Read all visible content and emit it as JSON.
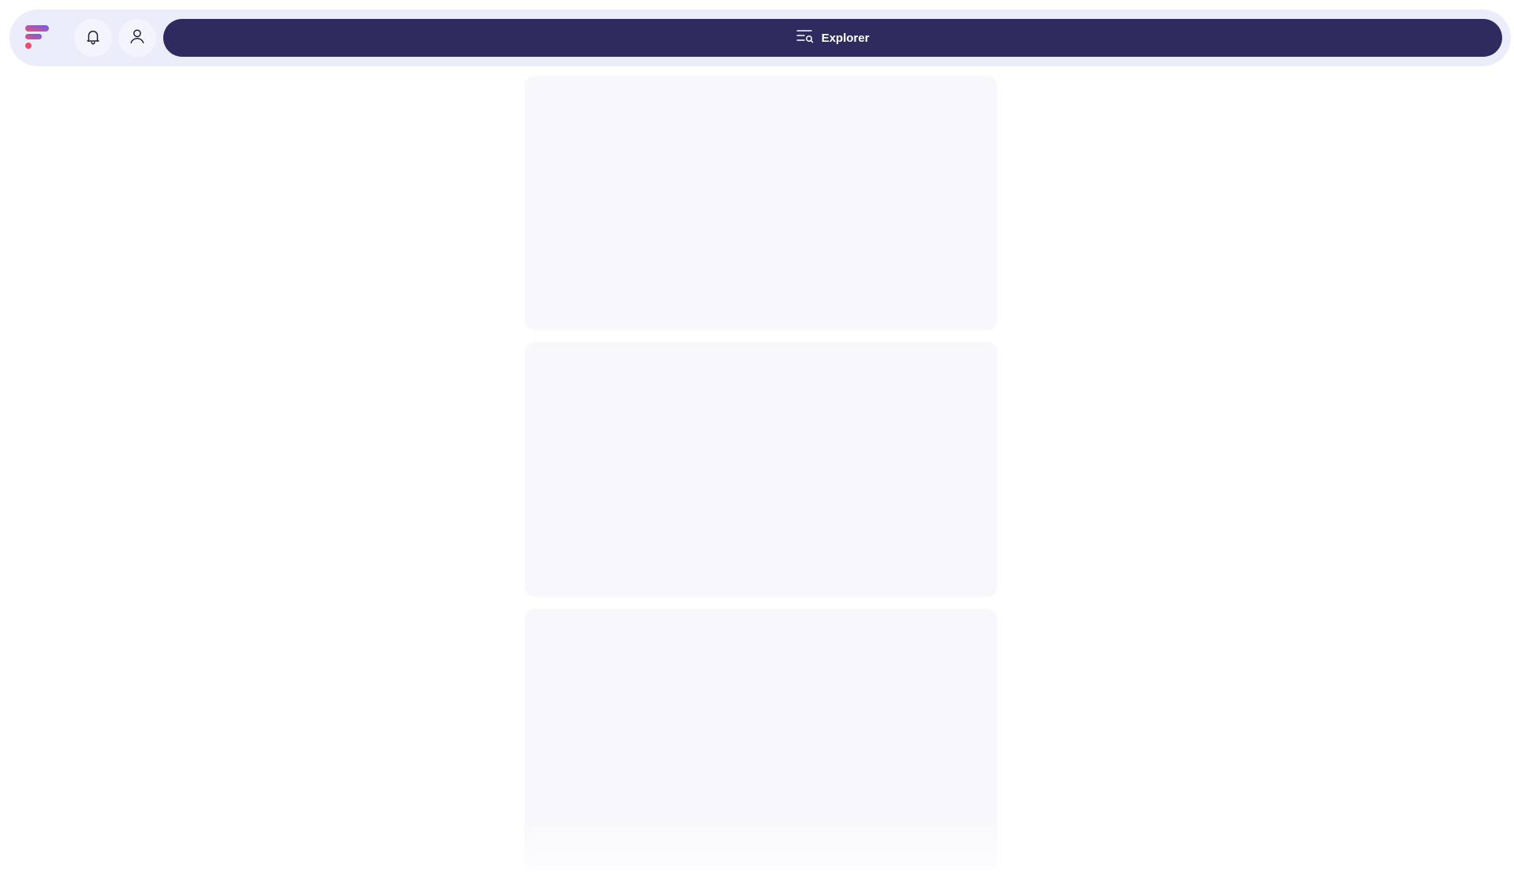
{
  "header": {
    "explorer_label": "Explorer",
    "icons": {
      "logo": "brand-logo-icon",
      "notifications": "bell-icon",
      "profile": "user-icon",
      "explorer": "list-search-icon"
    }
  },
  "feed": {
    "state": "loading-skeleton",
    "cards": [
      {
        "placeholder": true
      },
      {
        "placeholder": true
      },
      {
        "placeholder": true
      }
    ]
  },
  "colors": {
    "topbar_bg": "#ecedfb",
    "explorer_bg": "#2e2b5f",
    "card_bg": "#f8f8fc",
    "logo_gradient": [
      "#6a5cf6",
      "#ef4f6b"
    ]
  }
}
